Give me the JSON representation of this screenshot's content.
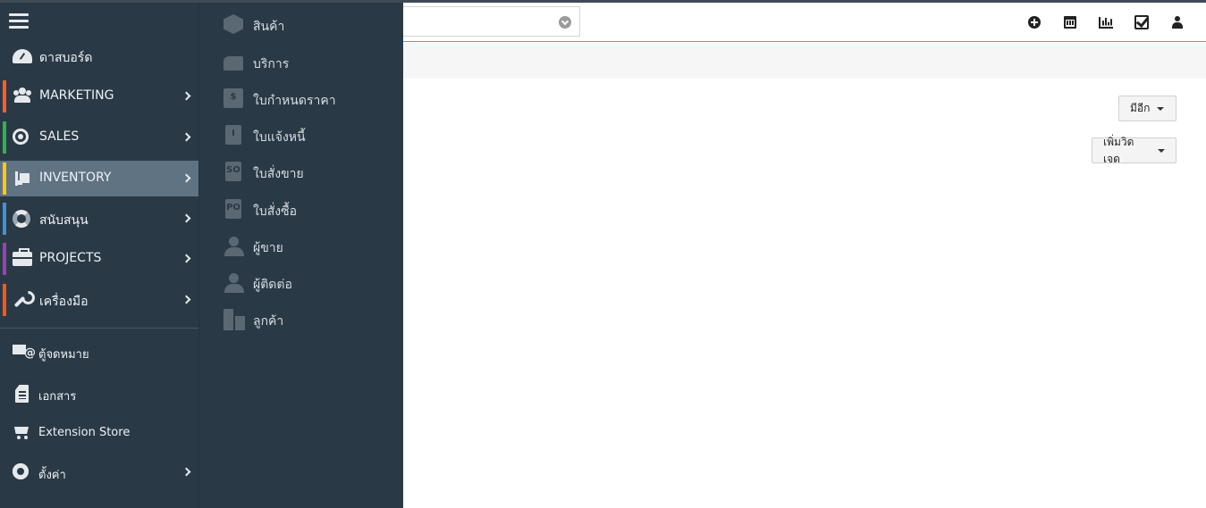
{
  "header": {
    "icons": [
      "plus-circle-icon",
      "calendar-icon",
      "bar-chart-icon",
      "checkbox-icon",
      "user-icon"
    ]
  },
  "buttons": {
    "more": "มีอีก",
    "add_widget": "เพิ่มวิดเจด"
  },
  "sidebar": {
    "items": [
      {
        "label": "ดาสบอร์ด",
        "icon": "dashboard-icon",
        "color": "",
        "has_submenu": false
      },
      {
        "label": "MARKETING",
        "icon": "users-icon",
        "color": "#e8633a",
        "has_submenu": true
      },
      {
        "label": "SALES",
        "icon": "target-icon",
        "color": "#3dab5a",
        "has_submenu": true
      },
      {
        "label": "INVENTORY",
        "icon": "inventory-icon",
        "color": "#f2c72e",
        "has_submenu": true,
        "active": true
      },
      {
        "label": "สนับสนุน",
        "icon": "lifebuoy-icon",
        "color": "#4a90c8",
        "has_submenu": true
      },
      {
        "label": "PROJECTS",
        "icon": "briefcase-icon",
        "color": "#8e4aa8",
        "has_submenu": true
      },
      {
        "label": "เครื่องมือ",
        "icon": "wrench-icon",
        "color": "#e0602e",
        "has_submenu": true
      }
    ],
    "utilities": [
      {
        "label": "ตู้จดหมาย",
        "icon": "mail-icon",
        "has_submenu": false
      },
      {
        "label": "เอกสาร",
        "icon": "document-icon",
        "has_submenu": false
      },
      {
        "label": "Extension Store",
        "icon": "cart-icon",
        "has_submenu": false
      },
      {
        "label": "ตั้งค่า",
        "icon": "gear-icon",
        "has_submenu": true
      }
    ]
  },
  "submenu": {
    "items": [
      {
        "label": "สินค้า",
        "icon": "product-box-icon"
      },
      {
        "label": "บริการ",
        "icon": "service-hand-icon"
      },
      {
        "label": "ใบกำหนดราคา",
        "icon": "price-book-icon",
        "glyph": "$"
      },
      {
        "label": "ใบแจ้งหนี้",
        "icon": "invoice-icon",
        "glyph": "I"
      },
      {
        "label": "ใบสั่งขาย",
        "icon": "sales-order-icon",
        "glyph": "SO"
      },
      {
        "label": "ใบสั่งซื้อ",
        "icon": "purchase-order-icon",
        "glyph": "PO"
      },
      {
        "label": "ผู้ขาย",
        "icon": "vendor-icon"
      },
      {
        "label": "ผู้ติดต่อ",
        "icon": "contact-icon"
      },
      {
        "label": "ลูกค้า",
        "icon": "organization-icon"
      }
    ]
  }
}
